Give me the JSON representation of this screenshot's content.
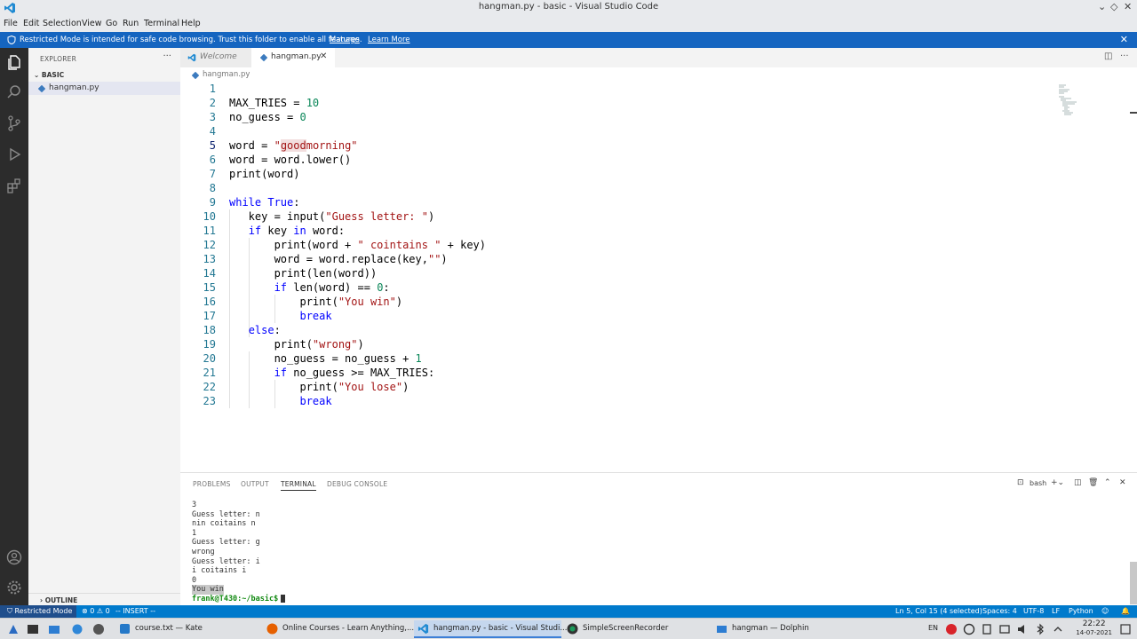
{
  "window": {
    "title": "hangman.py - basic - Visual Studio Code"
  },
  "menu": [
    "File",
    "Edit",
    "Selection",
    "View",
    "Go",
    "Run",
    "Terminal",
    "Help"
  ],
  "banner": {
    "message": "Restricted Mode is intended for safe code browsing. Trust this folder to enable all features.",
    "manage": "Manage",
    "learn_more": "Learn More"
  },
  "sidebar": {
    "header": "EXPLORER",
    "section": "BASIC",
    "file": "hangman.py",
    "outline": "OUTLINE"
  },
  "tabs": [
    {
      "label": "Welcome"
    },
    {
      "label": "hangman.py"
    }
  ],
  "breadcrumb": "hangman.py",
  "code_lines": [
    "1",
    "2",
    "3",
    "4",
    "5",
    "6",
    "7",
    "8",
    "9",
    "10",
    "11",
    "12",
    "13",
    "14",
    "15",
    "16",
    "17",
    "18",
    "19",
    "20",
    "21",
    "22",
    "23"
  ],
  "panel": {
    "tabs": [
      "PROBLEMS",
      "OUTPUT",
      "TERMINAL",
      "DEBUG CONSOLE"
    ],
    "shell": "bash"
  },
  "terminal": {
    "lines": [
      "3",
      "Guess letter: n",
      "nin coitains n",
      "1",
      "Guess letter: g",
      "wrong",
      "Guess letter: i",
      "i coitains i",
      "0",
      "You win"
    ],
    "prompt": "frank@T430:~/basic$"
  },
  "status": {
    "restricted": "Restricted Mode",
    "problems": "0",
    "warnings": "0",
    "mode": "-- INSERT --",
    "position": "Ln 5, Col 15 (4 selected)",
    "spaces": "Spaces: 4",
    "encoding": "UTF-8",
    "eol": "LF",
    "language": "Python"
  },
  "taskbar": {
    "tasks": [
      {
        "label": "course.txt — Kate"
      },
      {
        "label": "Online Courses - Learn Anything,..."
      },
      {
        "label": "hangman.py - basic - Visual Studi..."
      },
      {
        "label": "SimpleScreenRecorder"
      },
      {
        "label": "hangman — Dolphin"
      }
    ],
    "lang": "EN",
    "time": "22:22",
    "date": "14-07-2021"
  },
  "colors": {
    "accent": "#007acc",
    "banner": "#1565c0",
    "activity": "#2c2c2c"
  }
}
